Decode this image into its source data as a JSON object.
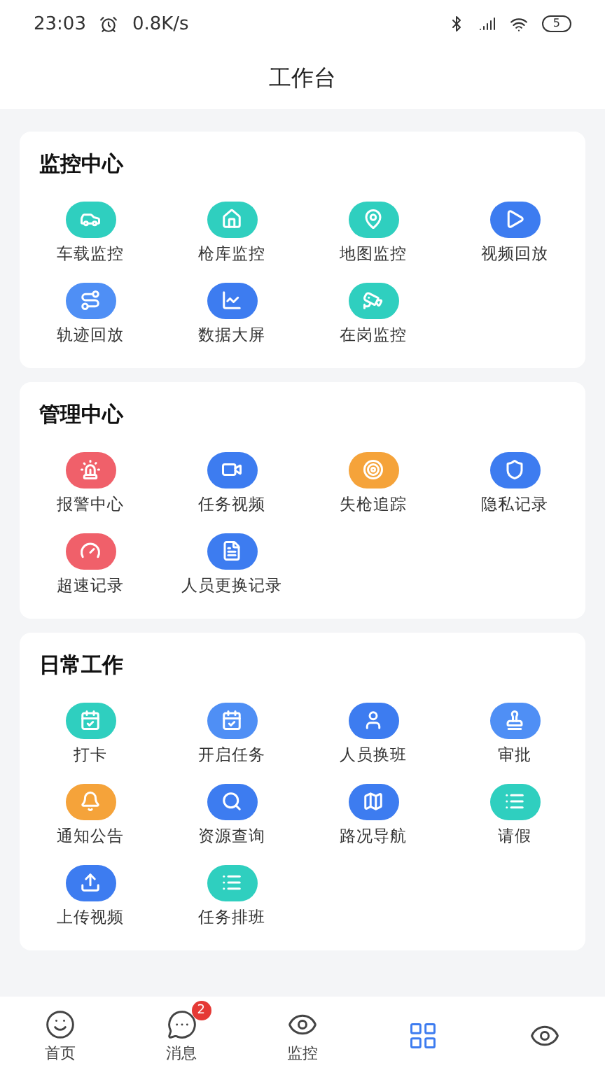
{
  "status_bar": {
    "time": "23:03",
    "speed": "0.8K/s",
    "battery": "5"
  },
  "title": "工作台",
  "sections": [
    {
      "title": "监控中心",
      "items": [
        {
          "label": "车载监控",
          "color": "#2fcfbf"
        },
        {
          "label": "枪库监控",
          "color": "#2fcfbf"
        },
        {
          "label": "地图监控",
          "color": "#2fcfbf"
        },
        {
          "label": "视频回放",
          "color": "#3d7cf0"
        },
        {
          "label": "轨迹回放",
          "color": "#4f8ff5"
        },
        {
          "label": "数据大屏",
          "color": "#3d7cf0"
        },
        {
          "label": "在岗监控",
          "color": "#2fcfbf"
        }
      ]
    },
    {
      "title": "管理中心",
      "items": [
        {
          "label": "报警中心",
          "color": "#f0606a"
        },
        {
          "label": "任务视频",
          "color": "#3d7cf0"
        },
        {
          "label": "失枪追踪",
          "color": "#f5a33a"
        },
        {
          "label": "隐私记录",
          "color": "#3d7cf0"
        },
        {
          "label": "超速记录",
          "color": "#f0606a"
        },
        {
          "label": "人员更换记录",
          "color": "#3d7cf0"
        }
      ]
    },
    {
      "title": "日常工作",
      "items": [
        {
          "label": "打卡",
          "color": "#2fcfbf"
        },
        {
          "label": "开启任务",
          "color": "#4f8ff5"
        },
        {
          "label": "人员换班",
          "color": "#3d7cf0"
        },
        {
          "label": "审批",
          "color": "#4f8ff5"
        },
        {
          "label": "通知公告",
          "color": "#f5a33a"
        },
        {
          "label": "资源查询",
          "color": "#3d7cf0"
        },
        {
          "label": "路况导航",
          "color": "#3d7cf0"
        },
        {
          "label": "请假",
          "color": "#2fcfbf"
        },
        {
          "label": "上传视频",
          "color": "#3d7cf0"
        },
        {
          "label": "任务排班",
          "color": "#2fcfbf"
        }
      ]
    }
  ],
  "nav": [
    {
      "label": "首页",
      "selected": false
    },
    {
      "label": "消息",
      "selected": false,
      "badge": "2"
    },
    {
      "label": "监控",
      "selected": false
    },
    {
      "selected": true
    },
    {
      "selected": false
    }
  ]
}
